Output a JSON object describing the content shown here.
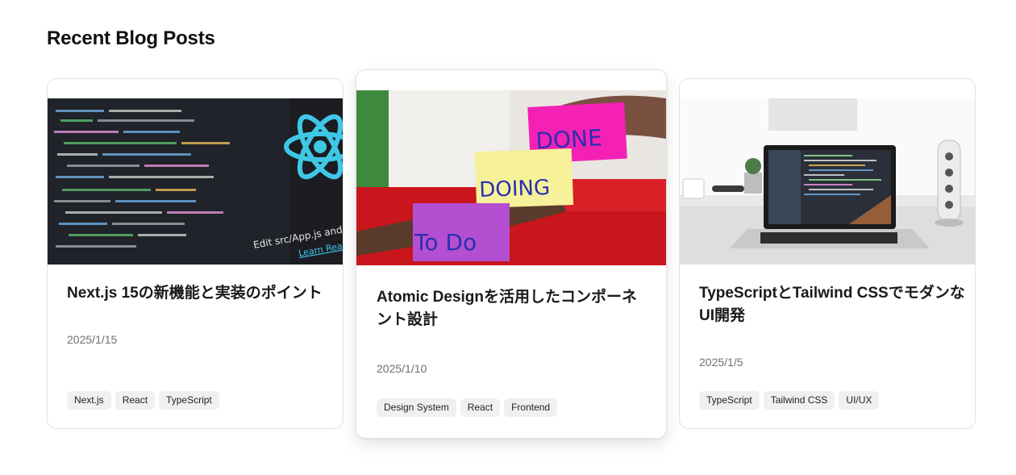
{
  "section": {
    "title": "Recent Blog Posts"
  },
  "posts": [
    {
      "title": "Next.js 15の新機能と実装のポイント",
      "date": "2025/1/15",
      "image_icon": "react-code-screen-image",
      "image_text": "Edit src/App.js and save",
      "image_link": "Learn React",
      "tags": [
        "Next.js",
        "React",
        "TypeScript"
      ]
    },
    {
      "title": "Atomic Designを活用したコンポーネント設計",
      "date": "2025/1/10",
      "image_icon": "sticky-notes-kanban-image",
      "image_notes": [
        "DONE",
        "DOING",
        "To Do"
      ],
      "tags": [
        "Design System",
        "React",
        "Frontend"
      ]
    },
    {
      "title": "TypeScriptとTailwind CSSでモダンなUI開発",
      "date": "2025/1/5",
      "image_icon": "laptop-desk-image",
      "tags": [
        "TypeScript",
        "Tailwind CSS",
        "UI/UX"
      ]
    }
  ],
  "colors": {
    "card_border": "#e3e3e3",
    "tag_bg": "#f0f0f0",
    "date": "#707070",
    "react_blue": "#3fc7e6"
  }
}
